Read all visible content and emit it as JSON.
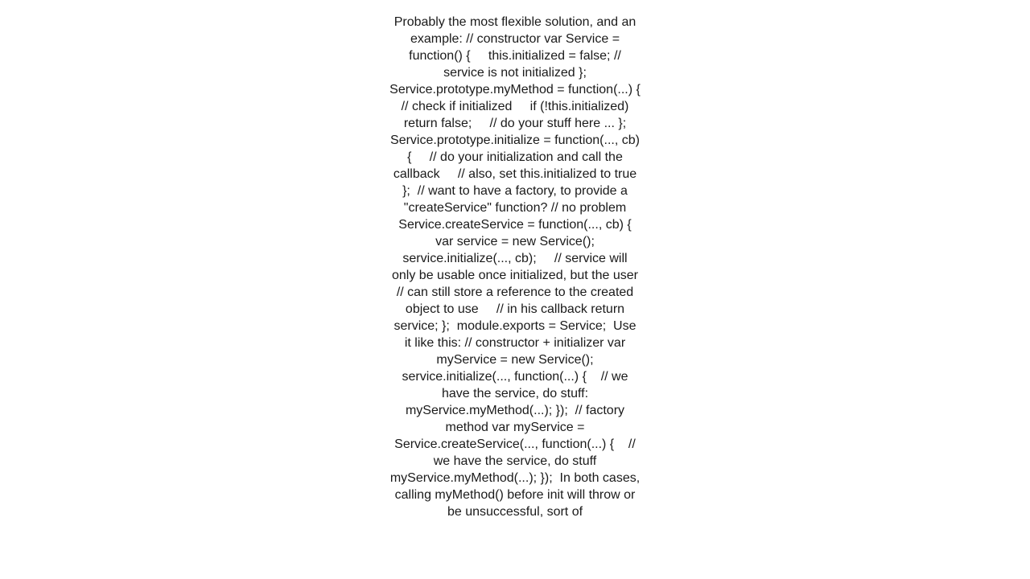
{
  "page": {
    "background_color": "#ffffff",
    "text_color": "#1a1a1a"
  },
  "answer": {
    "body": "Probably the most flexible solution, and an example: // constructor var Service = function() {     this.initialized = false; // service is not initialized };  Service.prototype.myMethod = function(...) {     // check if initialized     if (!this.initialized) return false;     // do your stuff here ... };  Service.prototype.initialize = function(..., cb) {     // do your initialization and call the callback     // also, set this.initialized to true };  // want to have a factory, to provide a \"createService\" function? // no problem Service.createService = function(..., cb) {     var service = new Service();     service.initialize(..., cb);     // service will only be usable once initialized, but the user     // can still store a reference to the created object to use     // in his callback return service; };  module.exports = Service;  Use it like this: // constructor + initializer var myService = new Service(); service.initialize(..., function(...) {    // we have the service, do stuff: myService.myMethod(...); });  // factory method var myService = Service.createService(..., function(...) {    // we have the service, do stuff myService.myMethod(...); });  In both cases, calling myMethod() before init will throw or be unsuccessful, sort of"
  }
}
